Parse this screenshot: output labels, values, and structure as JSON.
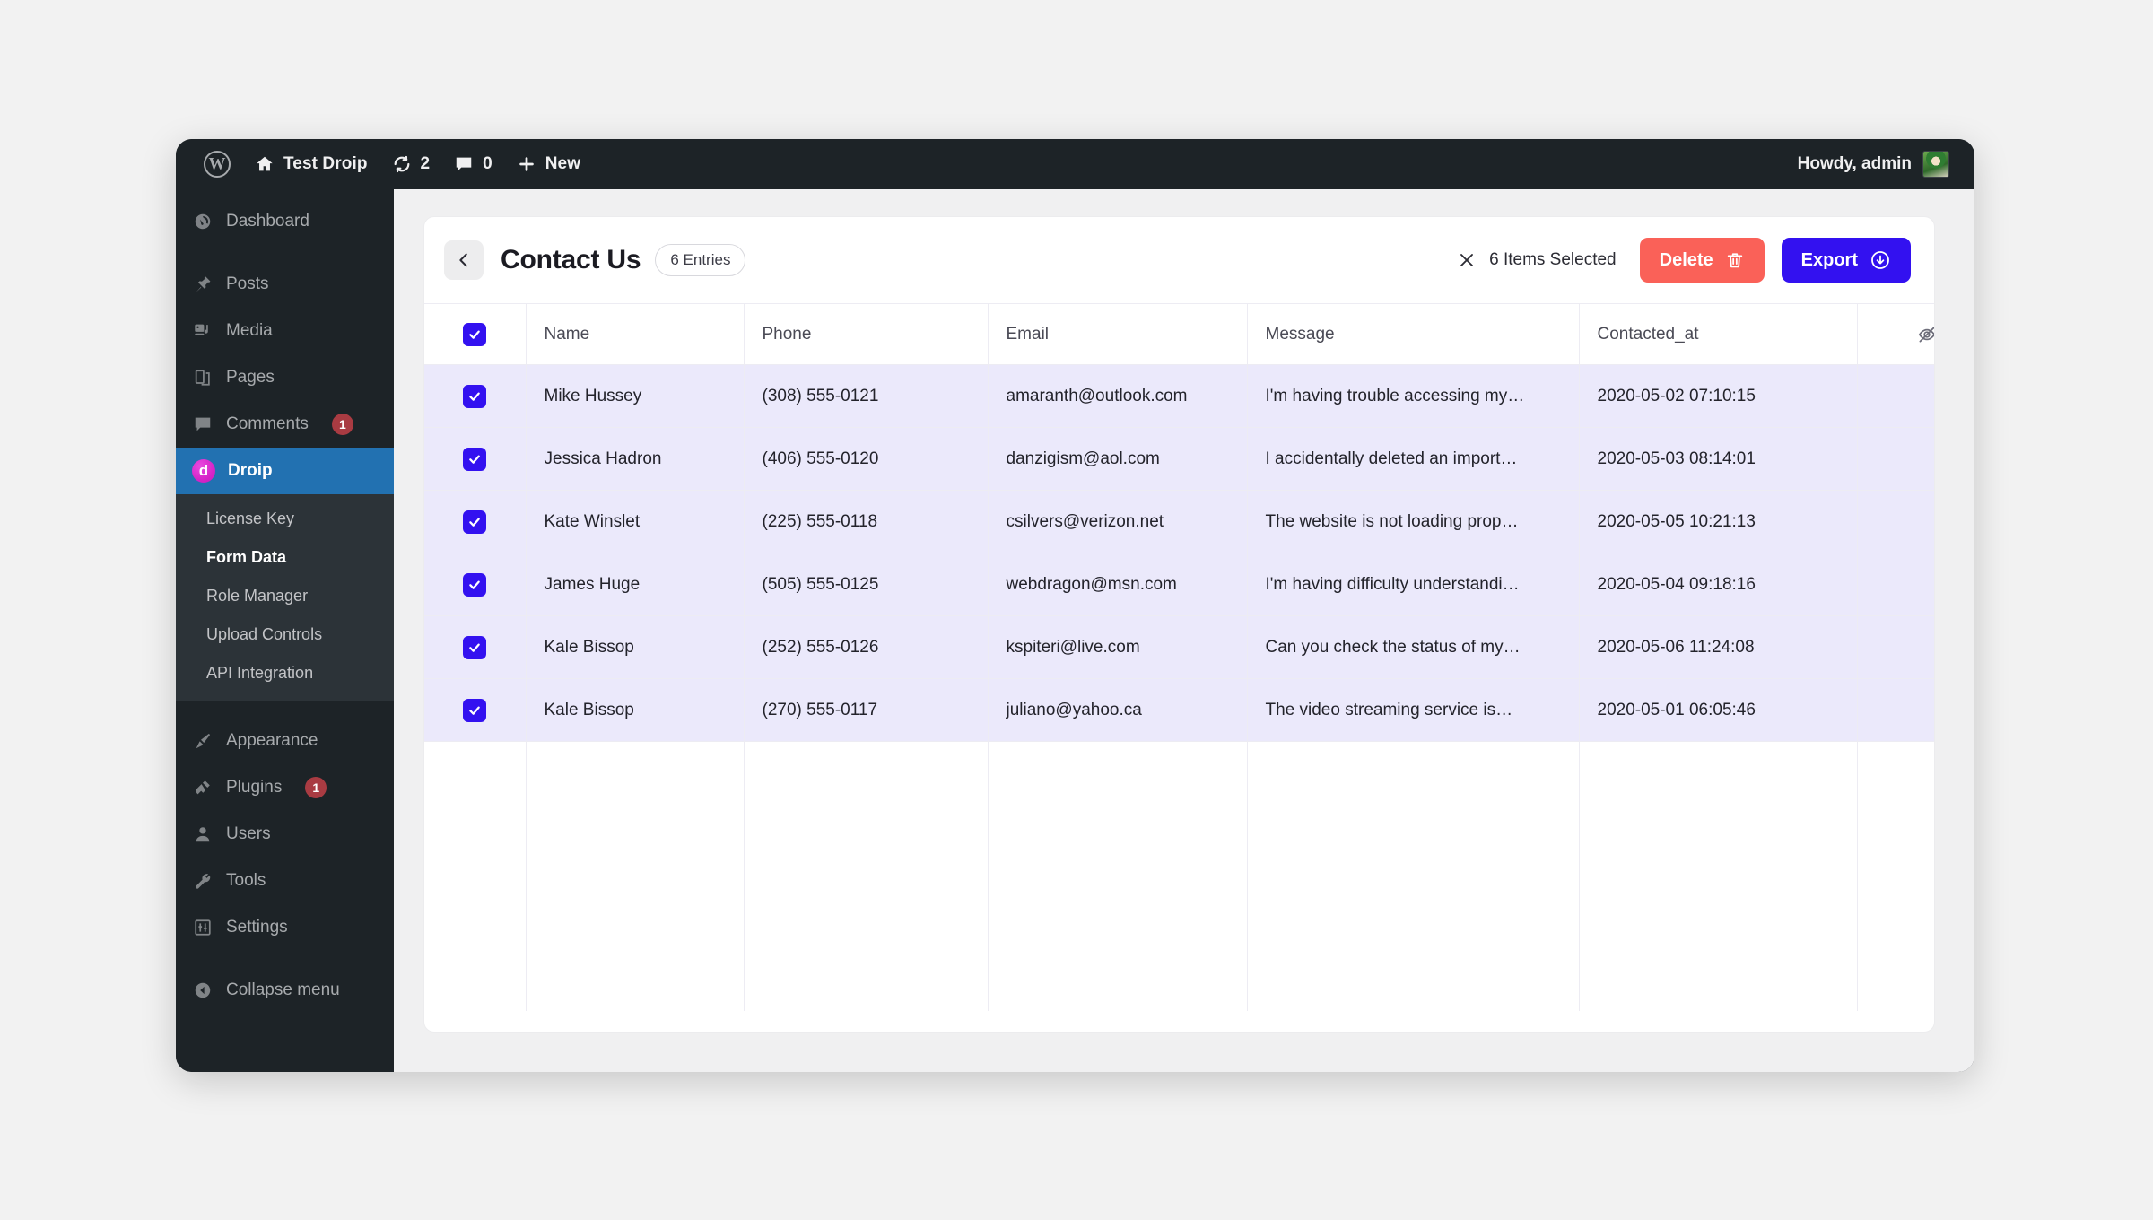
{
  "adminbar": {
    "site_name": "Test Droip",
    "updates_count": "2",
    "comments_count": "0",
    "new_label": "New",
    "howdy": "Howdy, admin"
  },
  "sidebar": {
    "items": [
      {
        "label": "Dashboard",
        "icon": "dashboard-icon",
        "badge": ""
      },
      {
        "label": "Posts",
        "icon": "pin-icon",
        "badge": ""
      },
      {
        "label": "Media",
        "icon": "media-icon",
        "badge": ""
      },
      {
        "label": "Pages",
        "icon": "pages-icon",
        "badge": ""
      },
      {
        "label": "Comments",
        "icon": "comment-icon",
        "badge": "1"
      },
      {
        "label": "Droip",
        "icon": "droip-logo-icon",
        "badge": ""
      },
      {
        "label": "Appearance",
        "icon": "brush-icon",
        "badge": ""
      },
      {
        "label": "Plugins",
        "icon": "plug-icon",
        "badge": "1"
      },
      {
        "label": "Users",
        "icon": "user-icon",
        "badge": ""
      },
      {
        "label": "Tools",
        "icon": "wrench-icon",
        "badge": ""
      },
      {
        "label": "Settings",
        "icon": "sliders-icon",
        "badge": ""
      },
      {
        "label": "Collapse menu",
        "icon": "collapse-icon",
        "badge": ""
      }
    ],
    "submenu": [
      {
        "label": "License Key",
        "current": false
      },
      {
        "label": "Form Data",
        "current": true
      },
      {
        "label": "Role Manager",
        "current": false
      },
      {
        "label": "Upload Controls",
        "current": false
      },
      {
        "label": "API Integration",
        "current": false
      }
    ]
  },
  "header": {
    "title": "Contact Us",
    "entries_pill": "6 Entries",
    "selection_text": "6 Items Selected",
    "delete_label": "Delete",
    "export_label": "Export"
  },
  "table": {
    "columns": [
      "Name",
      "Phone",
      "Email",
      "Message",
      "Contacted_at"
    ],
    "rows": [
      {
        "checked": true,
        "name": "Mike Hussey",
        "phone": "(308) 555-0121",
        "email": "amaranth@outlook.com",
        "message": "I'm having trouble accessing my…",
        "contacted_at": "2020-05-02 07:10:15"
      },
      {
        "checked": true,
        "name": "Jessica Hadron",
        "phone": "(406) 555-0120",
        "email": "danzigism@aol.com",
        "message": "I accidentally deleted an import…",
        "contacted_at": "2020-05-03 08:14:01"
      },
      {
        "checked": true,
        "name": "Kate Winslet",
        "phone": "(225) 555-0118",
        "email": "csilvers@verizon.net",
        "message": "The website is not loading prop…",
        "contacted_at": "2020-05-05 10:21:13"
      },
      {
        "checked": true,
        "name": "James Huge",
        "phone": "(505) 555-0125",
        "email": "webdragon@msn.com",
        "message": "I'm having difficulty understandi…",
        "contacted_at": "2020-05-04 09:18:16"
      },
      {
        "checked": true,
        "name": "Kale Bissop",
        "phone": "(252) 555-0126",
        "email": "kspiteri@live.com",
        "message": "Can you check the status of my…",
        "contacted_at": "2020-05-06 11:24:08"
      },
      {
        "checked": true,
        "name": "Kale Bissop",
        "phone": "(270) 555-0117",
        "email": "juliano@yahoo.ca",
        "message": "The video streaming service is…",
        "contacted_at": "2020-05-01 06:05:46"
      }
    ]
  },
  "colors": {
    "accent_blue": "#3311f0",
    "danger_red": "#fa6158",
    "wp_dark": "#1d2327",
    "wp_active_blue": "#2271b1",
    "droip_magenta": "#d625c8",
    "row_selected": "#ebe9fb"
  }
}
